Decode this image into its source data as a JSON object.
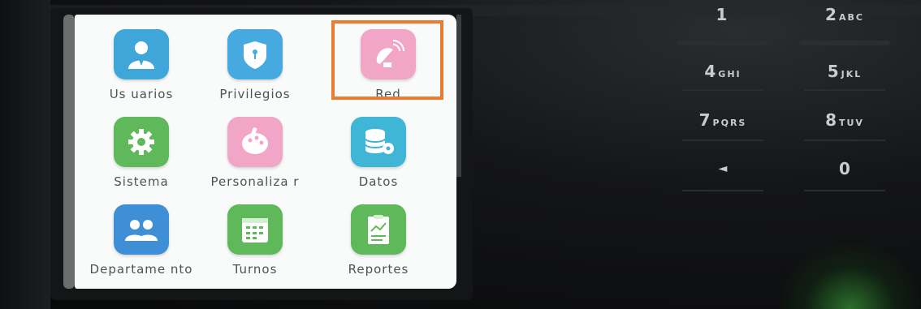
{
  "menu": {
    "items": [
      {
        "label": "Us uarios",
        "icon": "user-icon",
        "color": "#3ea6d9"
      },
      {
        "label": "Privilegios",
        "icon": "shield-icon",
        "color": "#46a9df"
      },
      {
        "label": "Red",
        "icon": "satellite-dish-icon",
        "color": "#f2a6c7"
      },
      {
        "label": "Sistema",
        "icon": "gear-icon",
        "color": "#5fb85a"
      },
      {
        "label": "Personaliza r",
        "icon": "palette-icon",
        "color": "#f2a6c7"
      },
      {
        "label": "Datos",
        "icon": "database-icon",
        "color": "#3fb6d6"
      },
      {
        "label": "Departame nto",
        "icon": "group-icon",
        "color": "#3f8fd6"
      },
      {
        "label": "Turnos",
        "icon": "calendar-icon",
        "color": "#5fb85a"
      },
      {
        "label": "Reportes",
        "icon": "report-icon",
        "color": "#5fb85a"
      }
    ],
    "selected": "Red",
    "highlight_color": "#ea7b31"
  },
  "keypad": {
    "keys": [
      {
        "num": "1",
        "letters": ""
      },
      {
        "num": "2",
        "letters": "ABC"
      },
      {
        "num": "4",
        "letters": "GHI"
      },
      {
        "num": "5",
        "letters": "JKL"
      },
      {
        "num": "7",
        "letters": "PQRS"
      },
      {
        "num": "8",
        "letters": "TUV"
      },
      {
        "num": "◄",
        "letters": ""
      },
      {
        "num": "0",
        "letters": ""
      }
    ]
  }
}
